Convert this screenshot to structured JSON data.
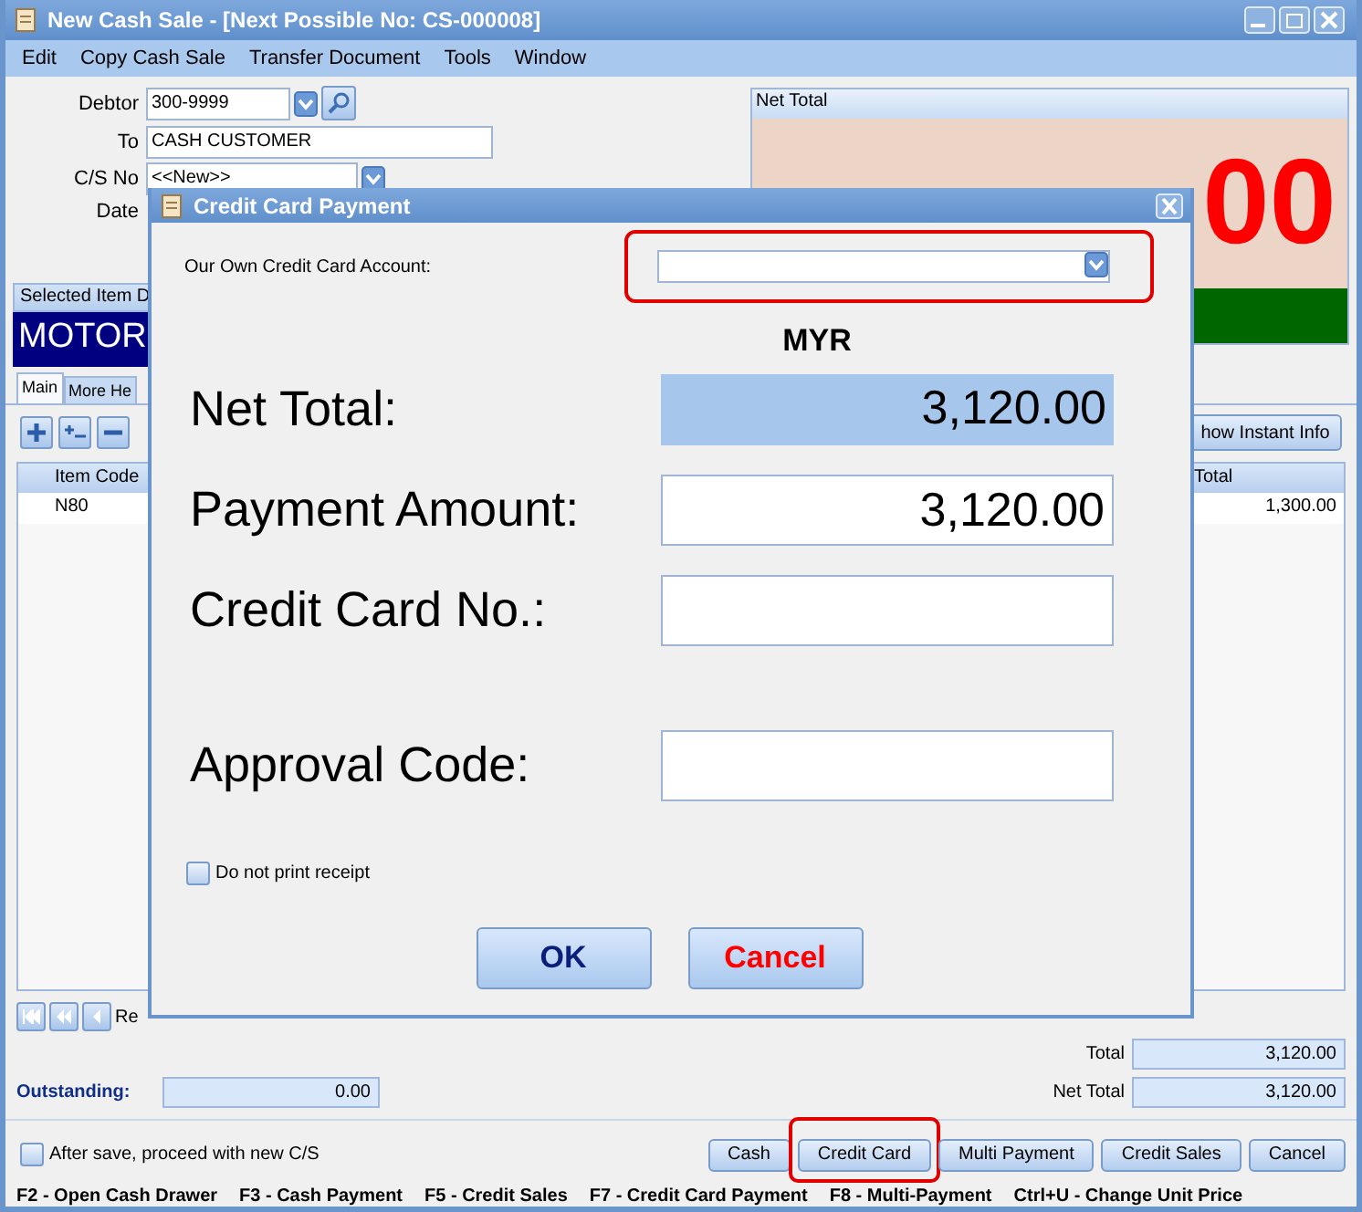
{
  "window": {
    "title": "New Cash Sale - [Next Possible No: CS-000008]"
  },
  "menu": [
    "Edit",
    "Copy Cash Sale",
    "Transfer Document",
    "Tools",
    "Window"
  ],
  "header_form": {
    "debtor": {
      "label": "Debtor",
      "value": "300-9999"
    },
    "to": {
      "label": "To",
      "value": "CASH CUSTOMER"
    },
    "cs_no": {
      "label": "C/S No",
      "value": "<<New>>"
    },
    "date": {
      "label": "Date"
    }
  },
  "selected_item": {
    "label": "Selected Item D",
    "description": "MOTOR"
  },
  "net_total_panel": {
    "title": "Net Total",
    "amount": "00"
  },
  "tabs": [
    {
      "label": "Main",
      "selected": true
    },
    {
      "label": "More He",
      "selected": false
    }
  ],
  "instant_info_button": "how Instant Info",
  "grid": {
    "columns": [
      "Item Code",
      "Total"
    ],
    "rows": [
      {
        "item_code": "N80",
        "total": "1,300.00"
      }
    ]
  },
  "navigator": {
    "label": "Re"
  },
  "totals": {
    "outstanding": {
      "label": "Outstanding:",
      "value": "0.00"
    },
    "total": {
      "label": "Total",
      "value": "3,120.00"
    },
    "net_total": {
      "label": "Net Total",
      "value": "3,120.00"
    }
  },
  "after_save": {
    "label": "After save, proceed with new C/S",
    "checked": false
  },
  "payment_buttons": [
    {
      "label": "Cash",
      "highlighted": false
    },
    {
      "label": "Credit Card",
      "highlighted": true
    },
    {
      "label": "Multi Payment",
      "highlighted": false
    },
    {
      "label": "Credit Sales",
      "highlighted": false
    },
    {
      "label": "Cancel",
      "highlighted": false
    }
  ],
  "shortcuts": [
    "F2 - Open Cash Drawer",
    "F3 - Cash Payment",
    "F5 - Credit Sales",
    "F7 - Credit Card Payment",
    "F8 - Multi-Payment",
    "Ctrl+U - Change Unit Price"
  ],
  "dialog": {
    "title": "Credit Card Payment",
    "account": {
      "label": "Our Own Credit Card Account:",
      "highlighted": true
    },
    "currency": "MYR",
    "fields": [
      {
        "label": "Net Total:",
        "value": "3,120.00",
        "kind": "readonly"
      },
      {
        "label": "Payment Amount:",
        "value": "3,120.00",
        "kind": "input"
      },
      {
        "label": "Credit Card No.:",
        "kind": "input"
      },
      {
        "label": "Approval Code:",
        "kind": "input"
      }
    ],
    "do_not_print": {
      "label": "Do not print receipt",
      "checked": false
    },
    "buttons": [
      {
        "label": "OK",
        "kind": "ok"
      },
      {
        "label": "Cancel",
        "kind": "cancel"
      }
    ]
  }
}
